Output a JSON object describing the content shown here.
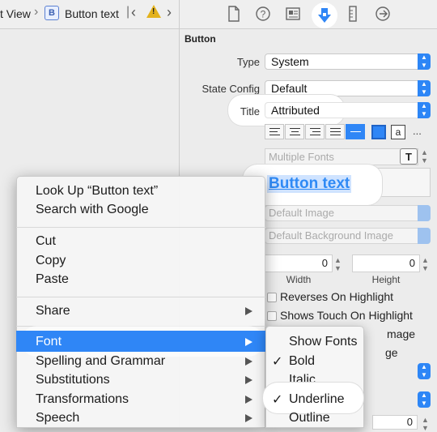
{
  "breadcrumb": {
    "parent": "t View",
    "item_badge": "B",
    "item": "Button text"
  },
  "inspector": {
    "toolbar": [
      "file-icon",
      "help-icon",
      "identity-icon",
      "attributes-icon",
      "size-icon",
      "connections-icon"
    ],
    "section_title": "Button",
    "type_label": "Type",
    "type_value": "System",
    "state_label": "State Config",
    "state_value": "Default",
    "title_label": "Title",
    "title_value": "Attributed",
    "font_placeholder": "Multiple Fonts",
    "font_button": "T",
    "button_text": "Button text",
    "image_placeholder": "Default Image",
    "bg_image_placeholder": "Default Background Image",
    "width_value": "0",
    "height_value": "0",
    "width_label": "Width",
    "height_label": "Height",
    "reverses_label": "Reverses On Highlight",
    "shows_touch_label": "Shows Touch On Highlight",
    "partial_image": "mage",
    "partial_ge": "ge",
    "small_a": "a",
    "more": "..."
  },
  "context_menu": {
    "items": [
      "Look Up “Button text”",
      "Search with Google",
      "Cut",
      "Copy",
      "Paste",
      "Share",
      "Font",
      "Spelling and Grammar",
      "Substitutions",
      "Transformations",
      "Speech"
    ]
  },
  "font_submenu": {
    "items": [
      "Show Fonts",
      "Bold",
      "Italic",
      "Underline",
      "Outline"
    ],
    "checkmark": "✓",
    "checked": [
      "Bold",
      "Underline"
    ]
  },
  "colors": {
    "accent": "#2f86f6",
    "link": "#2f8af5",
    "warning": "#e3b21c"
  }
}
